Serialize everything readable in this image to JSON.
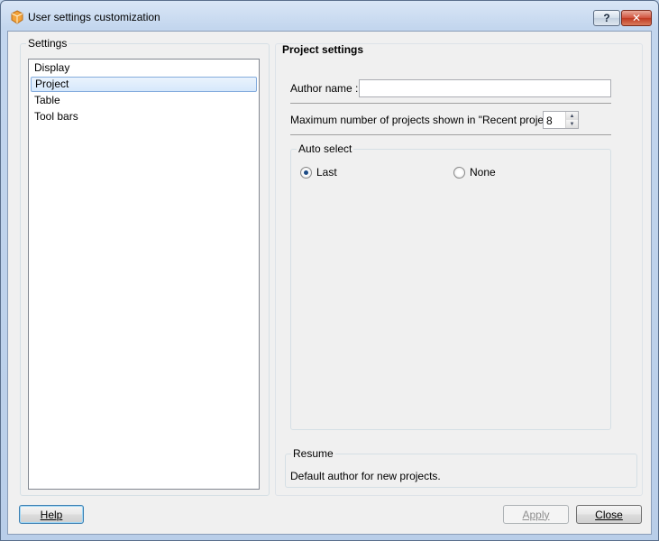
{
  "window": {
    "title": "User settings customization",
    "help_caption": "?",
    "close_caption": "✕"
  },
  "settings": {
    "group_title": "Settings",
    "items": [
      {
        "label": "Display",
        "selected": false
      },
      {
        "label": "Project",
        "selected": true
      },
      {
        "label": "Table",
        "selected": false
      },
      {
        "label": "Tool bars",
        "selected": false
      }
    ]
  },
  "project": {
    "title": "Project settings",
    "author_label": "Author name :",
    "author_value": "",
    "max_label": "Maximum number of projects shown in \"Recent projects\":",
    "max_value": "8",
    "autoselect": {
      "title": "Auto select",
      "options": [
        {
          "label": "Last",
          "checked": true
        },
        {
          "label": "None",
          "checked": false
        }
      ]
    }
  },
  "resume": {
    "title": "Resume",
    "text": "Default author for new projects."
  },
  "buttons": {
    "help": "Help",
    "apply": "Apply",
    "close": "Close"
  },
  "colors": {
    "accent": "#3c7fb1",
    "selection_border": "#84acdd",
    "radio_check": "#1d4b85"
  }
}
